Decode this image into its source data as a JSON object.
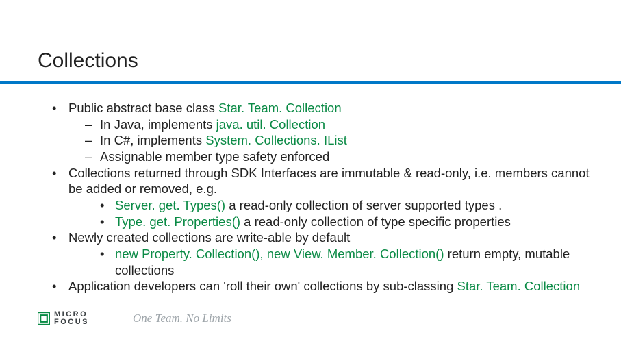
{
  "title": "Collections",
  "bullets": [
    {
      "segments": [
        {
          "t": "Public abstract base class  ",
          "g": false
        },
        {
          "t": "Star. Team. Collection",
          "g": true
        }
      ],
      "sub_dash": [
        {
          "segments": [
            {
              "t": "In Java, implements ",
              "g": false
            },
            {
              "t": "java. util. Collection",
              "g": true
            }
          ]
        },
        {
          "segments": [
            {
              "t": "In C#, implements ",
              "g": false
            },
            {
              "t": "System. Collections. IList",
              "g": true
            }
          ]
        },
        {
          "segments": [
            {
              "t": "Assignable member type safety enforced",
              "g": false
            }
          ]
        }
      ]
    },
    {
      "segments": [
        {
          "t": "Collections returned through SDK Interfaces are immutable & read-only, i.e. members cannot be added or removed, e.g.",
          "g": false
        }
      ],
      "sub_dot": [
        {
          "segments": [
            {
              "t": "Server. get. Types() ",
              "g": true
            },
            {
              "t": "a read-only collection of server supported types .",
              "g": false
            }
          ]
        },
        {
          "segments": [
            {
              "t": "Type. get. Properties() ",
              "g": true
            },
            {
              "t": "a read-only collection of type specific properties",
              "g": false
            }
          ]
        }
      ]
    },
    {
      "segments": [
        {
          "t": "Newly created collections are write-able by default",
          "g": false
        }
      ],
      "sub_dot": [
        {
          "segments": [
            {
              "t": "new Property. Collection(), new View. Member. Collection() ",
              "g": true
            },
            {
              "t": "return empty, mutable collections",
              "g": false
            }
          ]
        }
      ]
    },
    {
      "segments": [
        {
          "t": "Application developers can 'roll their own' collections by sub-classing ",
          "g": false
        },
        {
          "t": "Star. Team. Collection",
          "g": true
        }
      ]
    }
  ],
  "footer": {
    "logo_line1": "MICRO",
    "logo_line2": "FOCUS",
    "tagline": "One Team. No Limits"
  },
  "colors": {
    "accent_blue": "#0078c8",
    "accent_green": "#0a8a45",
    "tagline_grey": "#9da4a9"
  }
}
